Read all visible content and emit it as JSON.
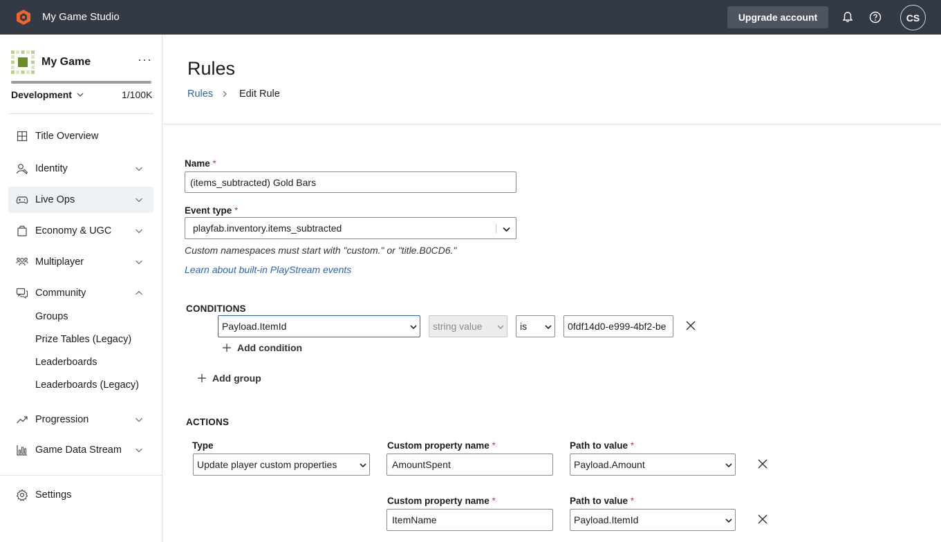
{
  "topbar": {
    "app_name": "My Game Studio",
    "upgrade_label": "Upgrade account",
    "avatar_initials": "CS",
    "brand_color": "#f0642d"
  },
  "sidebar": {
    "game_name": "My Game",
    "more_label": "···",
    "environment": "Development",
    "usage": "1/100K",
    "usage_fraction": 0.99,
    "items": [
      {
        "label": "Title Overview",
        "icon": "grid-icon"
      },
      {
        "label": "Identity",
        "icon": "identity-icon"
      },
      {
        "label": "Live Ops",
        "icon": "gamepad-icon"
      },
      {
        "label": "Economy & UGC",
        "icon": "economy-icon"
      },
      {
        "label": "Multiplayer",
        "icon": "multiplayer-icon"
      },
      {
        "label": "Community",
        "icon": "community-icon"
      },
      {
        "label": "Progression",
        "icon": "trend-icon"
      },
      {
        "label": "Game Data Stream",
        "icon": "bar-chart-icon"
      }
    ],
    "community_subitems": [
      "Groups",
      "Prize Tables (Legacy)",
      "Leaderboards",
      "Leaderboards (Legacy)"
    ],
    "settings_label": "Settings"
  },
  "page": {
    "title": "Rules",
    "breadcrumb_root": "Rules",
    "breadcrumb_current": "Edit Rule"
  },
  "form": {
    "name_label": "Name",
    "required_mark": "*",
    "name_value": "(items_subtracted) Gold Bars",
    "event_type_label": "Event type",
    "event_type_value": "playfab.inventory.items_subtracted",
    "hint": "Custom namespaces must start with \"custom.\" or \"title.B0CD6.\"",
    "learn_link": "Learn about built-in PlayStream events"
  },
  "conditions": {
    "title": "CONDITIONS",
    "property": "Payload.ItemId",
    "value_type": "string value",
    "operator": "is",
    "value": "0fdf14d0-e999-4bf2-be",
    "add_condition": "Add condition",
    "add_group": "Add group"
  },
  "actions": {
    "title": "ACTIONS",
    "type_label": "Type",
    "type_value": "Update player custom properties",
    "custom_property_label": "Custom property name",
    "path_label": "Path to value",
    "rows": [
      {
        "property": "AmountSpent",
        "path": "Payload.Amount"
      },
      {
        "property": "ItemName",
        "path": "Payload.ItemId"
      }
    ]
  }
}
